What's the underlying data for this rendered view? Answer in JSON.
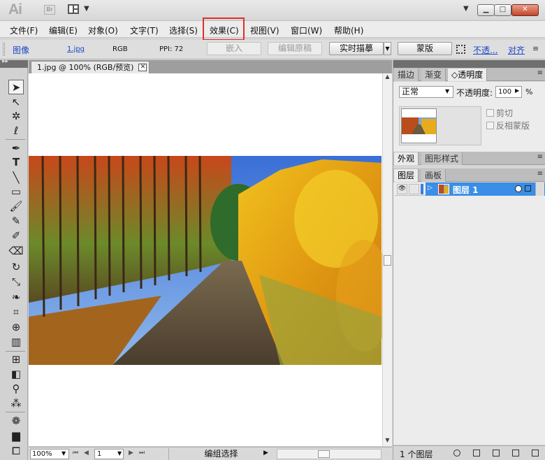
{
  "titlebar": {
    "logo": "Ai",
    "bridge_label": "Br"
  },
  "menu": {
    "items": [
      {
        "label": "文件(F)"
      },
      {
        "label": "编辑(E)"
      },
      {
        "label": "对象(O)"
      },
      {
        "label": "文字(T)"
      },
      {
        "label": "选择(S)"
      },
      {
        "label": "效果(C)"
      },
      {
        "label": "视图(V)"
      },
      {
        "label": "窗口(W)"
      },
      {
        "label": "帮助(H)"
      }
    ],
    "highlighted": "效果(C)",
    "highlight_color": "#e0302a"
  },
  "control": {
    "object_type": "图像",
    "file_name": "1.jpg",
    "color_mode": "RGB",
    "ppi": "PPI: 72",
    "embed_label": "嵌入",
    "edit_original_label": "编辑原稿",
    "live_trace_label": "实时描摹",
    "mask_label": "蒙版",
    "opacity_link": "不透...",
    "align_link": "对齐"
  },
  "document": {
    "tab_title": "1.jpg @ 100% (RGB/预览)"
  },
  "status": {
    "zoom": "100%",
    "page": "1",
    "text": "编组选择"
  },
  "panels": {
    "transparency": {
      "tabs": [
        {
          "label": "描边"
        },
        {
          "label": "渐变"
        },
        {
          "label": "◇透明度"
        }
      ],
      "blend_mode": "正常",
      "opacity_label": "不透明度:",
      "opacity_value": "100",
      "opacity_unit": "%",
      "clip_label": "剪切",
      "invert_mask_label": "反相蒙版"
    },
    "appearance": {
      "tabs": [
        {
          "label": "外观"
        },
        {
          "label": "图形样式"
        }
      ]
    },
    "layers": {
      "tabs": [
        {
          "label": "图层"
        },
        {
          "label": "画板"
        }
      ],
      "layer_name": "图层 1",
      "layer_color": "#3b7de1",
      "count_label": "1 个图层"
    }
  },
  "colors": {
    "selection_blue": "#3a8ee6",
    "link_blue": "#1a46c8"
  },
  "tools": [
    "selection-tool-icon",
    "direct-selection-tool-icon",
    "magic-wand-tool-icon",
    "lasso-tool-icon",
    "pen-tool-icon",
    "type-tool-icon",
    "line-tool-icon",
    "rectangle-tool-icon",
    "paintbrush-tool-icon",
    "pencil-tool-icon",
    "blob-brush-tool-icon",
    "eraser-tool-icon",
    "rotate-tool-icon",
    "scale-tool-icon",
    "warp-tool-icon",
    "free-transform-tool-icon",
    "shape-builder-tool-icon",
    "graph-tool-icon",
    "mesh-tool-icon",
    "gradient-tool-icon",
    "eyedropper-tool-icon",
    "blend-tool-icon",
    "symbol-sprayer-tool-icon",
    "column-graph-tool-icon",
    "artboard-tool-icon"
  ]
}
